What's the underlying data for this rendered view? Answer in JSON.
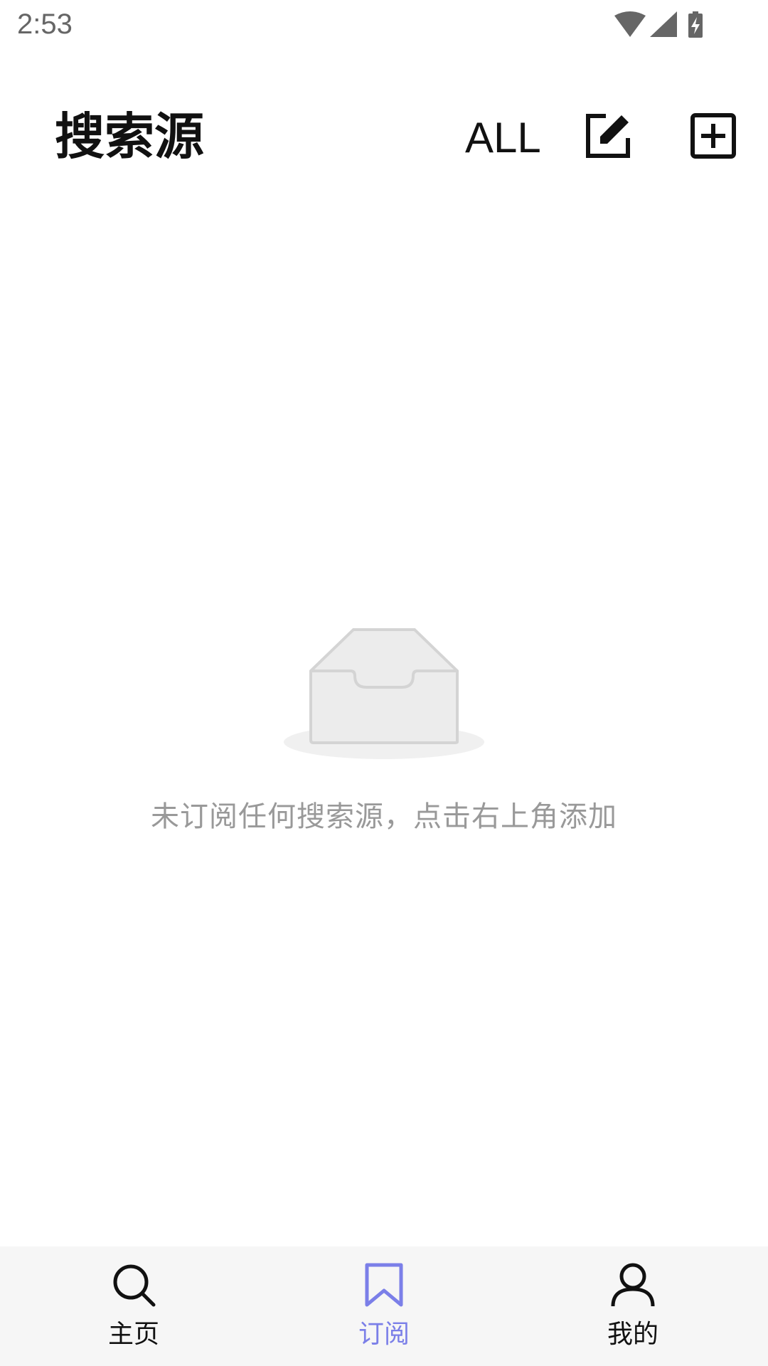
{
  "status_bar": {
    "time": "2:53",
    "icons": [
      "wifi-icon",
      "signal-icon",
      "battery-charging-icon"
    ]
  },
  "app_bar": {
    "title": "搜索源",
    "filter_label": "ALL",
    "edit_icon": "edit-icon",
    "add_icon": "add-box-icon"
  },
  "empty_state": {
    "icon": "empty-inbox-icon",
    "message": "未订阅任何搜索源，点击右上角添加"
  },
  "bottom_nav": {
    "items": [
      {
        "label": "主页",
        "icon": "search-icon",
        "active": false
      },
      {
        "label": "订阅",
        "icon": "bookmark-icon",
        "active": true
      },
      {
        "label": "我的",
        "icon": "person-icon",
        "active": false
      }
    ]
  },
  "colors": {
    "accent": "#7b7fe8",
    "text_primary": "#111111",
    "text_hint": "#999999",
    "nav_background": "#f6f6f6"
  }
}
